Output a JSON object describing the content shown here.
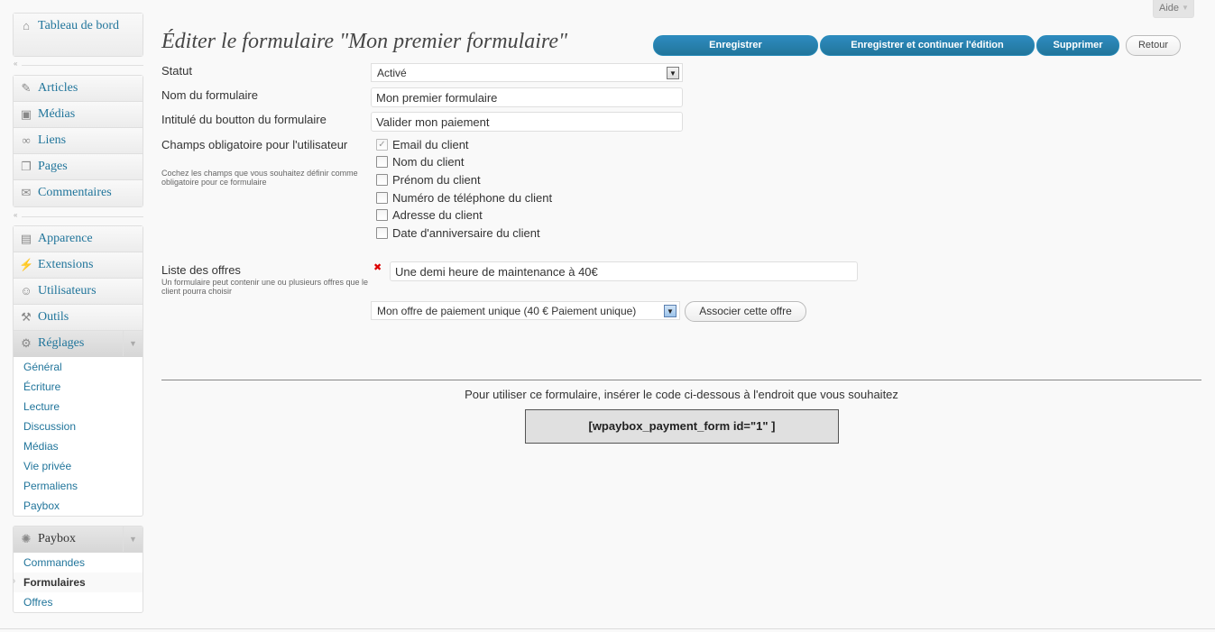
{
  "help_tab": {
    "label": "Aide"
  },
  "sidebar": {
    "dashboard": "Tableau de bord",
    "group1": [
      "Articles",
      "Médias",
      "Liens",
      "Pages",
      "Commentaires"
    ],
    "group2": [
      "Apparence",
      "Extensions",
      "Utilisateurs",
      "Outils",
      "Réglages"
    ],
    "settings_submenu": [
      "Général",
      "Écriture",
      "Lecture",
      "Discussion",
      "Médias",
      "Vie privée",
      "Permaliens",
      "Paybox"
    ],
    "paybox": "Paybox",
    "paybox_submenu": [
      "Commandes",
      "Formulaires",
      "Offres"
    ]
  },
  "page": {
    "title": "Éditer le formulaire \"Mon premier formulaire\"",
    "buttons": {
      "save": "Enregistrer",
      "save_continue": "Enregistrer et continuer l'édition",
      "delete": "Supprimer",
      "back": "Retour"
    }
  },
  "form": {
    "status_label": "Statut",
    "status_value": "Activé",
    "name_label": "Nom du formulaire",
    "name_value": "Mon premier formulaire",
    "button_label": "Intitulé du boutton du formulaire",
    "button_value": "Valider mon paiement",
    "required_label": "Champs obligatoire pour l'utilisateur",
    "required_hint": "Cochez les champs que vous souhaitez définir comme obligatoire pour ce formulaire",
    "required_fields": [
      {
        "label": "Email du client",
        "checked": true
      },
      {
        "label": "Nom du client",
        "checked": false
      },
      {
        "label": "Prénom du client",
        "checked": false
      },
      {
        "label": "Numéro de téléphone du client",
        "checked": false
      },
      {
        "label": "Adresse du client",
        "checked": false
      },
      {
        "label": "Date d'anniversaire du client",
        "checked": false
      }
    ],
    "offers_label": "Liste des offres",
    "offers_hint": "Un formulaire peut contenir une ou plusieurs offres que le client pourra choisir",
    "offer_item": "Une demi heure de maintenance à 40€",
    "offer_select": "Mon offre de paiement unique  (40 € Paiement unique)",
    "associate_button": "Associer cette offre"
  },
  "usage": {
    "text": "Pour utiliser ce formulaire, insérer le code ci-dessous à l'endroit que vous souhaitez",
    "shortcode": "[wpaybox_payment_form id=\"1\" ]"
  }
}
